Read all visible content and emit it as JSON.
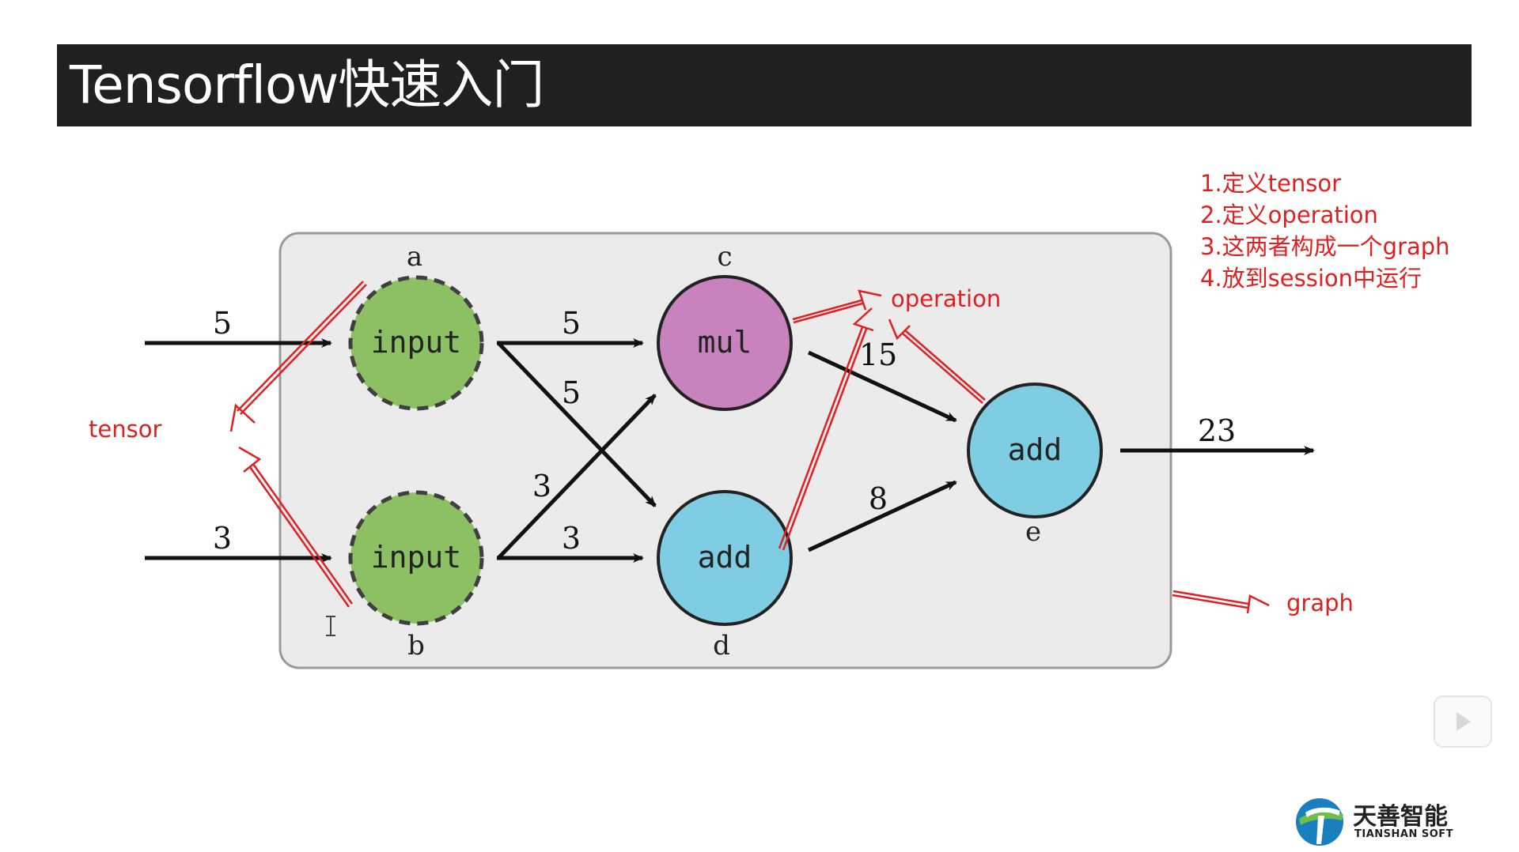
{
  "slide": {
    "title": "Tensorflow快速入门"
  },
  "steps": [
    "1.定义tensor",
    "2.定义operation",
    "3.这两者构成一个graph",
    "4.放到session中运行"
  ],
  "diagram": {
    "nodes": {
      "a": {
        "letter": "a",
        "label": "input"
      },
      "b": {
        "letter": "b",
        "label": "input"
      },
      "c": {
        "letter": "c",
        "label": "mul"
      },
      "d": {
        "letter": "d",
        "label": "add"
      },
      "e": {
        "letter": "e",
        "label": "add"
      }
    },
    "edges": {
      "in_a": "5",
      "in_b": "3",
      "a_c": "5",
      "a_d": "5",
      "b_c": "3",
      "b_d": "3",
      "c_e": "15",
      "d_e": "8",
      "out": "23"
    }
  },
  "annotations": {
    "tensor": "tensor",
    "operation": "operation",
    "graph": "graph"
  },
  "logo": {
    "cn": "天善智能",
    "en": "TIANSHAN SOFT"
  },
  "colors": {
    "title_bar": "#202020",
    "annotation_red": "#e02020",
    "input_node": "#8cc063",
    "mul_node": "#c883bf",
    "add_node": "#7ecde2",
    "graph_panel": "#ebebec"
  }
}
